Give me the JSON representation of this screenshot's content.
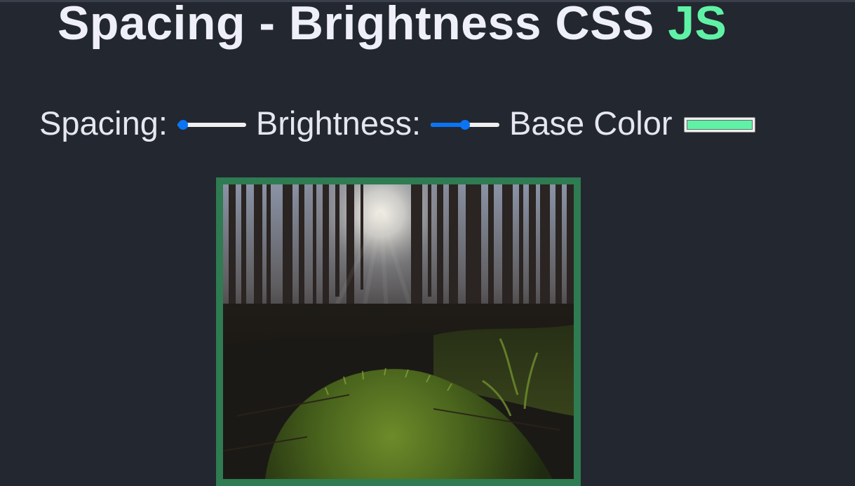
{
  "heading": {
    "text": "Spacing - Brightness CSS ",
    "highlight": "JS"
  },
  "controls": {
    "spacing_label": "Spacing:",
    "spacing_value": 0.08,
    "brightness_label": "Brightness:",
    "brightness_value": 0.5,
    "base_color_label": "Base Color",
    "base_color_value": "#5ff2a6"
  },
  "colors": {
    "background": "#232730",
    "accent": "#5ff2a6",
    "frame": "#2f7b52",
    "slider_fill": "#0a74f5"
  },
  "image": {
    "subject": "forest-sunlight-moss-photo"
  }
}
